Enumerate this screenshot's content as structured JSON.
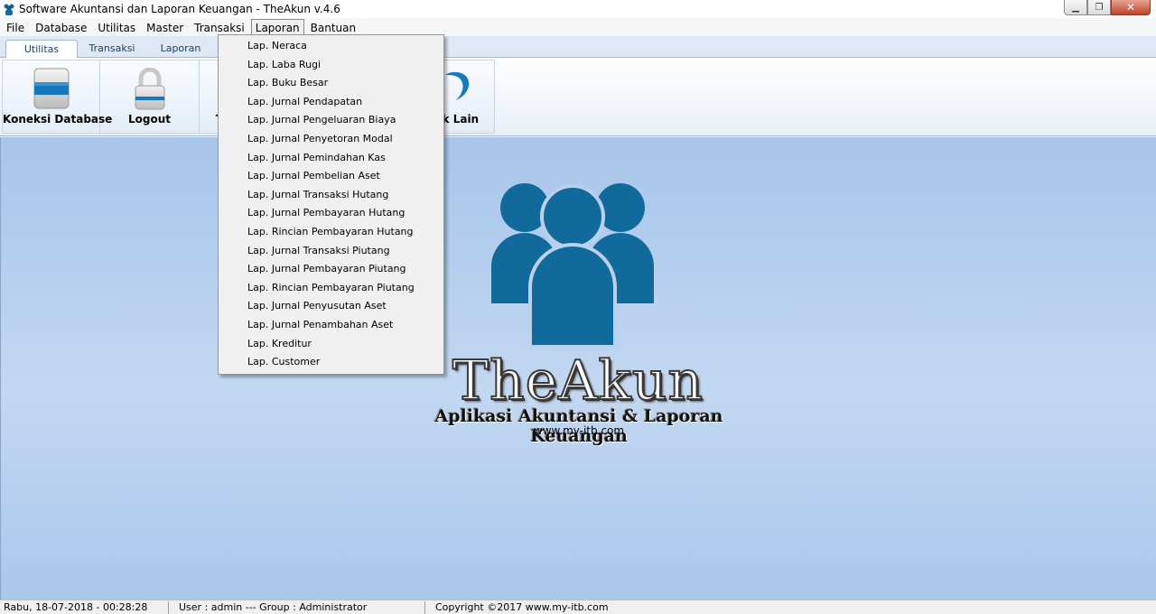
{
  "window": {
    "title": "Software Akuntansi dan Laporan Keuangan - TheAkun v.4.6",
    "minimize_icon": "minimize-icon",
    "restore_icon": "restore-icon",
    "close_icon": "close-icon"
  },
  "menubar": {
    "items": [
      "File",
      "Database",
      "Utilitas",
      "Master",
      "Transaksi",
      "Laporan",
      "Bantuan"
    ],
    "active": "Laporan"
  },
  "tabs": {
    "items": [
      "Utilitas",
      "Transaksi",
      "Laporan"
    ],
    "selected": "Utilitas"
  },
  "ribbon": {
    "buttons": [
      {
        "label": "Koneksi Database",
        "icon": "database-icon"
      },
      {
        "label": "Logout",
        "icon": "lock-icon"
      },
      {
        "label": "T",
        "icon": "hidden-icon"
      },
      {
        "label": "uk Lain",
        "icon": "heart-icon"
      }
    ]
  },
  "dropdown": {
    "items": [
      "Lap. Neraca",
      "Lap. Laba Rugi",
      "Lap. Buku Besar",
      "Lap. Jurnal Pendapatan",
      "Lap. Jurnal Pengeluaran Biaya",
      "Lap. Jurnal Penyetoran Modal",
      "Lap. Jurnal Pemindahan Kas",
      "Lap. Jurnal Pembelian Aset",
      "Lap. Jurnal Transaksi Hutang",
      "Lap. Jurnal Pembayaran Hutang",
      "Lap. Rincian Pembayaran Hutang",
      "Lap. Jurnal Transaksi Piutang",
      "Lap. Jurnal Pembayaran Piutang",
      "Lap. Rincian Pembayaran Piutang",
      "Lap. Jurnal Penyusutan Aset",
      "Lap. Jurnal Penambahan Aset",
      "Lap. Kreditur",
      "Lap. Customer"
    ]
  },
  "splash": {
    "brand": "TheAkun",
    "tagline": "Aplikasi Akuntansi & Laporan Keuangan",
    "website": "www.my-itb.com",
    "logo_icon": "users-group-icon",
    "logo_color": "#116a9c"
  },
  "statusbar": {
    "datetime": "Rabu,  18-07-2018 - 00:28:28",
    "user": "User : admin  --- Group : Administrator",
    "copyright": "Copyright ©2017 www.my-itb.com"
  }
}
